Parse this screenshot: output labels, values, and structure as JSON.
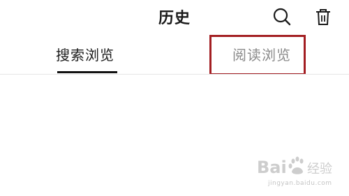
{
  "header": {
    "title": "历史",
    "icons": [
      "search-icon",
      "trash-icon"
    ]
  },
  "tabs": [
    {
      "label": "搜索浏览",
      "active": true
    },
    {
      "label": "阅读浏览",
      "active": false
    }
  ],
  "colors": {
    "active_text": "#1a1a1a",
    "inactive_text": "#8a8a8a",
    "underline": "#111111",
    "highlight_border": "#a31e22",
    "divider": "#e6e6e6"
  },
  "watermark": {
    "logo_text": "Baidu 经验",
    "url": "jingyan.baidu.com"
  }
}
